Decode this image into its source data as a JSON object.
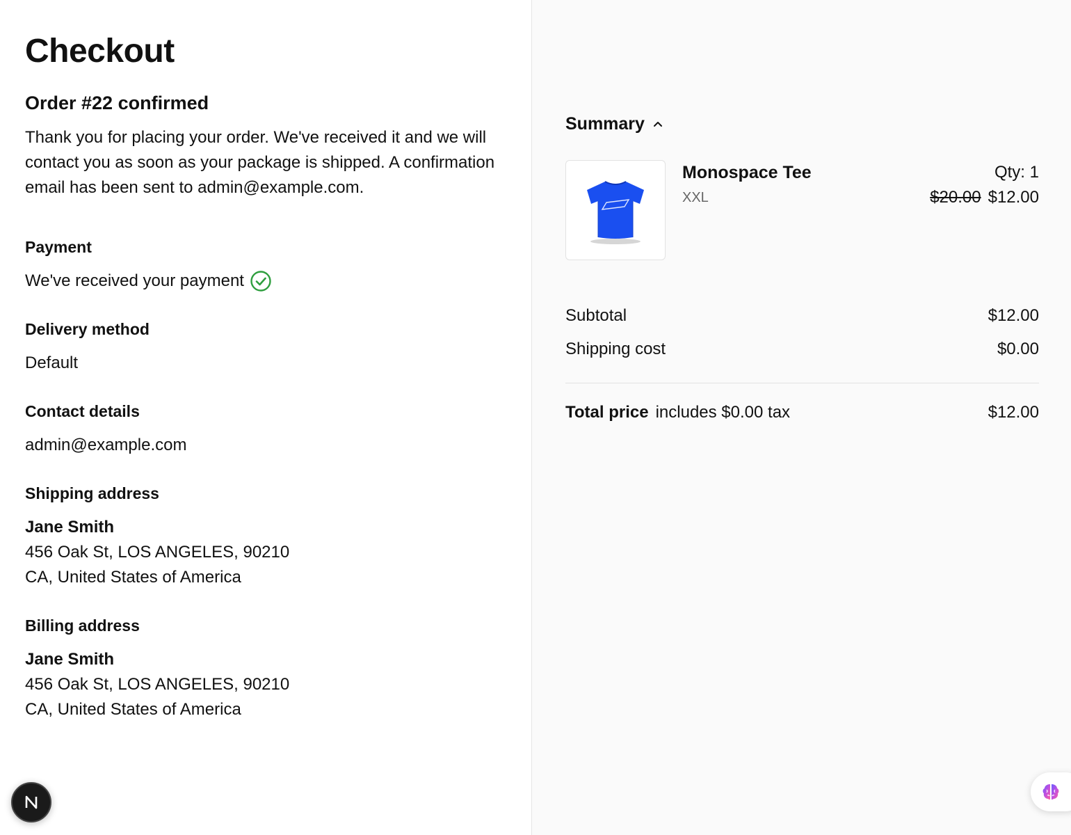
{
  "page": {
    "title": "Checkout"
  },
  "order": {
    "heading": "Order #22 confirmed",
    "message": "Thank you for placing your order. We've received it and we will contact you as soon as your package is shipped. A confirmation email has been sent to admin@example.com."
  },
  "payment": {
    "heading": "Payment",
    "status": "We've received your payment",
    "status_color": "#2e9e3e"
  },
  "delivery": {
    "heading": "Delivery method",
    "value": "Default"
  },
  "contact": {
    "heading": "Contact details",
    "email": "admin@example.com"
  },
  "shipping": {
    "heading": "Shipping address",
    "name": "Jane Smith",
    "line1": "456 Oak St, LOS ANGELES, 90210",
    "line2": "CA, United States of America"
  },
  "billing": {
    "heading": "Billing address",
    "name": "Jane Smith",
    "line1": "456 Oak St, LOS ANGELES, 90210",
    "line2": "CA, United States of America"
  },
  "summary": {
    "label": "Summary",
    "toggle_icon": "chevron-up-icon",
    "items": [
      {
        "name": "Monospace Tee",
        "variant": "XXL",
        "qty": "Qty: 1",
        "old_price": "$20.00",
        "price": "$12.00",
        "image_icon": "tshirt-icon",
        "image_color": "#1a4ff0"
      }
    ],
    "subtotal_label": "Subtotal",
    "subtotal_value": "$12.00",
    "shipping_label": "Shipping cost",
    "shipping_value": "$0.00",
    "total_label": "Total price",
    "total_tax_note": "includes $0.00 tax",
    "total_value": "$12.00"
  },
  "widgets": {
    "next_badge_letter": "N",
    "ai_widget_icon": "brain-icon"
  }
}
